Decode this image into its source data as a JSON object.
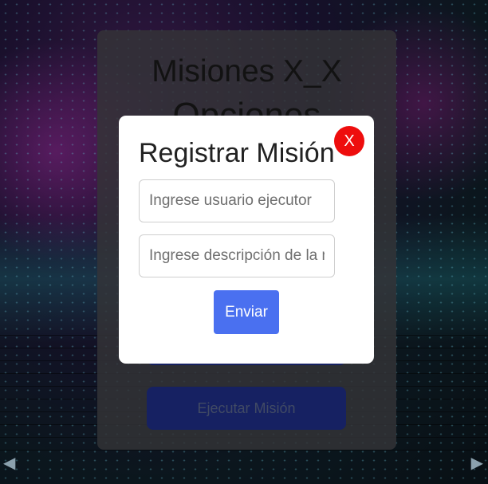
{
  "background": {
    "arrow_left": "◀",
    "arrow_right": "▶"
  },
  "panel": {
    "title": "Misiones X_X",
    "subtitle": "Opciones",
    "hidden_button_label": "",
    "execute_button_label": "Ejecutar Misión"
  },
  "modal": {
    "title": "Registrar Misión",
    "close_label": "X",
    "user_placeholder": "Ingrese usuario ejecutor",
    "description_placeholder": "Ingrese descripción de la misión",
    "submit_label": "Enviar"
  },
  "colors": {
    "close": "#ee0d0d",
    "submit": "#4a70f0",
    "panel_button": "#1a2670"
  }
}
